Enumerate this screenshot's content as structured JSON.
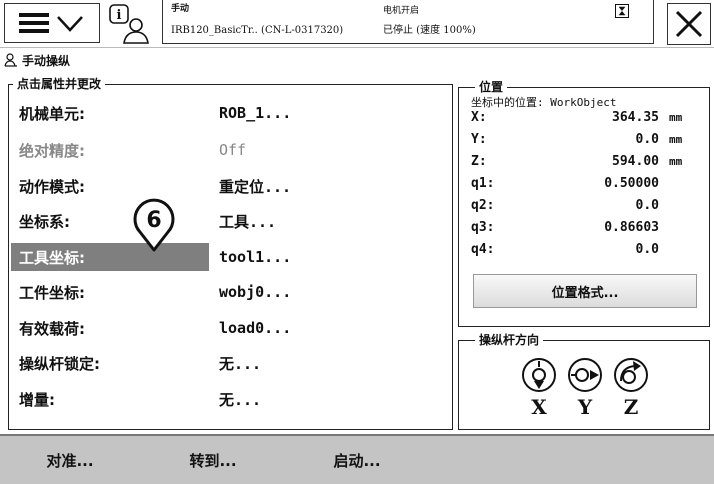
{
  "status": {
    "mode": "手动",
    "system": "IRB120_BasicTr.. (CN-L-0317320)",
    "motor": "电机开启",
    "speed": "已停止 (速度 100%)"
  },
  "window": {
    "title": "手动操纵"
  },
  "properties": {
    "legend": "点击属性并更改",
    "rows": [
      {
        "label": "机械单元:",
        "value": "ROB_1...",
        "dim": false,
        "selected": false
      },
      {
        "label": "绝对精度:",
        "value": "Off",
        "dim": true,
        "selected": false
      },
      {
        "label": "动作模式:",
        "value": "重定位...",
        "dim": false,
        "selected": false
      },
      {
        "label": "坐标系:",
        "value": "工具...",
        "dim": false,
        "selected": false
      },
      {
        "label": "工具坐标:",
        "value": "tool1...",
        "dim": false,
        "selected": true
      },
      {
        "label": "工件坐标:",
        "value": "wobj0...",
        "dim": false,
        "selected": false
      },
      {
        "label": "有效载荷:",
        "value": "load0...",
        "dim": false,
        "selected": false
      },
      {
        "label": "操纵杆锁定:",
        "value": "无...",
        "dim": false,
        "selected": false
      },
      {
        "label": "增量:",
        "value": "无...",
        "dim": false,
        "selected": false
      }
    ]
  },
  "callout": {
    "number": "6"
  },
  "position": {
    "legend": "位置",
    "subtitle": "坐标中的位置: WorkObject",
    "rows": [
      {
        "label": "X:",
        "value": "364.35",
        "unit": "mm"
      },
      {
        "label": "Y:",
        "value": "0.0",
        "unit": "mm"
      },
      {
        "label": "Z:",
        "value": "594.00",
        "unit": "mm"
      },
      {
        "label": "q1:",
        "value": "0.50000",
        "unit": ""
      },
      {
        "label": "q2:",
        "value": "0.0",
        "unit": ""
      },
      {
        "label": "q3:",
        "value": "0.86603",
        "unit": ""
      },
      {
        "label": "q4:",
        "value": "0.0",
        "unit": ""
      }
    ],
    "format_button": "位置格式..."
  },
  "joystick": {
    "legend": "操纵杆方向",
    "axes": [
      {
        "label": "X",
        "icon": "joystick-updown-icon"
      },
      {
        "label": "Y",
        "icon": "joystick-leftright-icon"
      },
      {
        "label": "Z",
        "icon": "joystick-rotate-icon"
      }
    ]
  },
  "commands": [
    {
      "label": "对准..."
    },
    {
      "label": "转到..."
    },
    {
      "label": "启动..."
    }
  ]
}
